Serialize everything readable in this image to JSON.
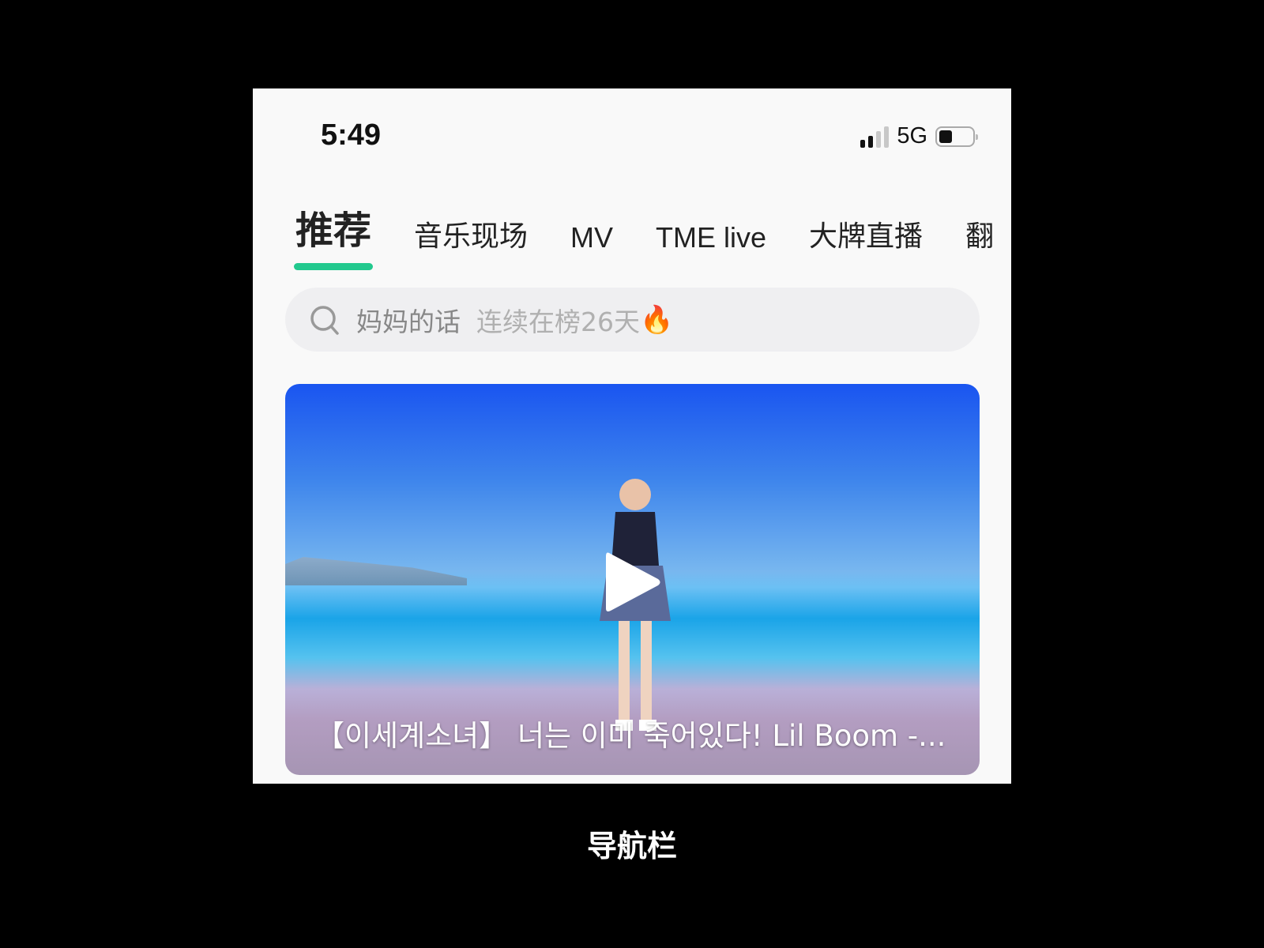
{
  "status_bar": {
    "time": "5:49",
    "network": "5G",
    "battery_percent": 35,
    "signal_bars": 2
  },
  "tabs": [
    {
      "label": "推荐",
      "active": true
    },
    {
      "label": "音乐现场",
      "active": false
    },
    {
      "label": "MV",
      "active": false
    },
    {
      "label": "TME live",
      "active": false
    },
    {
      "label": "大牌直播",
      "active": false
    },
    {
      "label": "翻",
      "active": false
    }
  ],
  "search": {
    "hint_title": "妈妈的话",
    "hint_meta": "连续在榜26天",
    "hint_icon": "🔥"
  },
  "video_card": {
    "title": "【이세계소녀】 너는 이미 죽어있다! Lil Boom -..."
  },
  "subtitle": "导航栏",
  "colors": {
    "accent": "#22c98e",
    "background": "#f9f9f9"
  }
}
